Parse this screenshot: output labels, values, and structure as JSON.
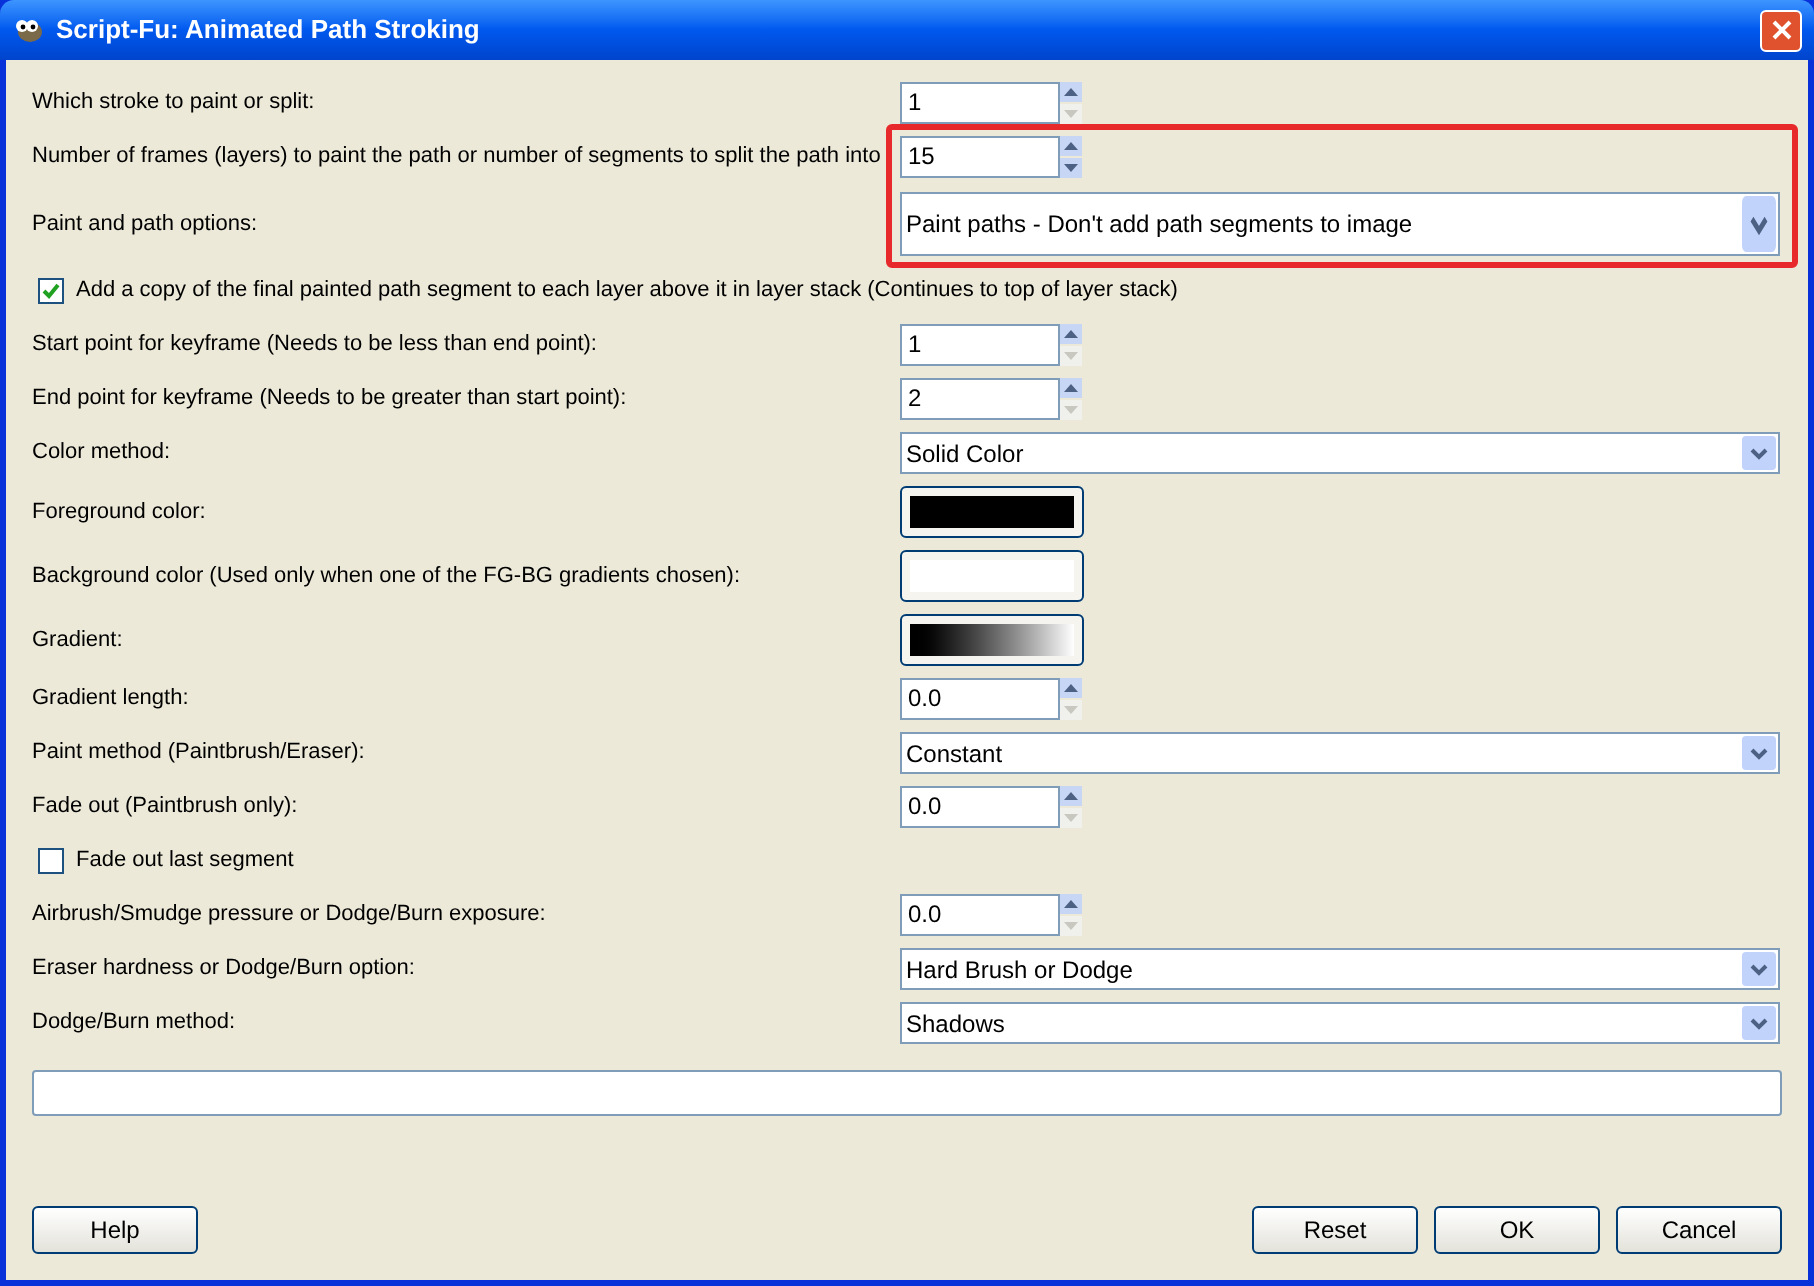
{
  "window": {
    "title": "Script-Fu: Animated Path Stroking"
  },
  "rows": [
    {
      "kind": "spin",
      "label": "Which stroke to paint or split:",
      "value": "1",
      "down_disabled": true,
      "highlighted": false
    },
    {
      "kind": "spin",
      "label": "Number of frames (layers) to paint the path or number of segments to split the path into",
      "value": "15",
      "down_disabled": false,
      "highlighted": true
    },
    {
      "kind": "combo",
      "label": "Paint and path options:",
      "value": "Paint paths - Don't add path segments to image",
      "highlighted": true
    },
    {
      "kind": "checkbox",
      "label": "Add a copy of the final painted path segment to each layer above it in layer stack (Continues to top of layer stack)",
      "checked": true,
      "highlighted": false
    },
    {
      "kind": "spin",
      "label": "Start point for keyframe (Needs to be less than end point):",
      "value": "1",
      "down_disabled": true,
      "highlighted": false
    },
    {
      "kind": "spin",
      "label": "End point for keyframe (Needs to be greater than start point):",
      "value": "2",
      "down_disabled": true,
      "highlighted": false
    },
    {
      "kind": "combo",
      "label": "Color method:",
      "value": "Solid Color",
      "highlighted": false
    },
    {
      "kind": "color",
      "label": "Foreground color:",
      "color": "#000000",
      "highlighted": false
    },
    {
      "kind": "color",
      "label": "Background color (Used only when one of the FG-BG gradients chosen):",
      "color": "#ffffff",
      "highlighted": false
    },
    {
      "kind": "gradient",
      "label": "Gradient:",
      "highlighted": false
    },
    {
      "kind": "spin",
      "label": "Gradient length:",
      "value": "0.0",
      "down_disabled": true,
      "highlighted": false
    },
    {
      "kind": "combo",
      "label": "Paint method (Paintbrush/Eraser):",
      "value": "Constant",
      "highlighted": false
    },
    {
      "kind": "spin",
      "label": "Fade out (Paintbrush only):",
      "value": "0.0",
      "down_disabled": true,
      "highlighted": false
    },
    {
      "kind": "checkbox",
      "label": "Fade out last segment",
      "checked": false,
      "highlighted": false
    },
    {
      "kind": "spin",
      "label": "Airbrush/Smudge pressure or Dodge/Burn exposure:",
      "value": "0.0",
      "down_disabled": true,
      "highlighted": false
    },
    {
      "kind": "combo",
      "label": "Eraser hardness or Dodge/Burn option:",
      "value": "Hard Brush or Dodge",
      "highlighted": false
    },
    {
      "kind": "combo",
      "label": "Dodge/Burn method:",
      "value": "Shadows",
      "highlighted": false
    }
  ],
  "buttons": [
    "Help",
    "Reset",
    "OK",
    "Cancel"
  ]
}
